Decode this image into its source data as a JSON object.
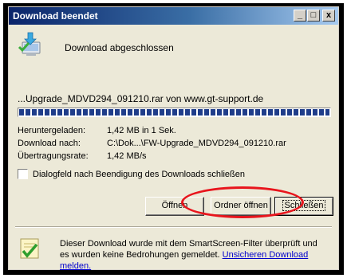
{
  "window": {
    "title": "Download beendet",
    "controls": {
      "minimize": "_",
      "maximize": "□",
      "close": "x"
    }
  },
  "status": {
    "message": "Download abgeschlossen"
  },
  "file": {
    "line": "...Upgrade_MDVD294_091210.rar von www.gt-support.de"
  },
  "progress": {
    "percent": 100
  },
  "info": {
    "downloaded_label": "Heruntergeladen:",
    "downloaded_value": "1,42 MB in 1 Sek.",
    "target_label": "Download nach:",
    "target_value": "C:\\Dok...\\FW-Upgrade_MDVD294_091210.rar",
    "rate_label": "Übertragungsrate:",
    "rate_value": "1,42 MB/s"
  },
  "checkbox": {
    "label": "Dialogfeld nach Beendigung des Downloads schließen",
    "checked": false
  },
  "buttons": {
    "open": "Öffnen",
    "open_folder": "Ordner öffnen",
    "close": "Schließen"
  },
  "smartscreen": {
    "text": "Dieser Download wurde mit dem SmartScreen-Filter überprüft und es wurden keine Bedrohungen gemeldet.",
    "link": "Unsicheren Download melden."
  },
  "icons": {
    "top": "download-computer-icon",
    "bottom": "smartscreen-check-icon"
  },
  "colors": {
    "title_start": "#0a246a",
    "title_end": "#a6caf0",
    "progress": "#1f3d8a",
    "highlight": "#e8141c",
    "link": "#0000cc"
  }
}
